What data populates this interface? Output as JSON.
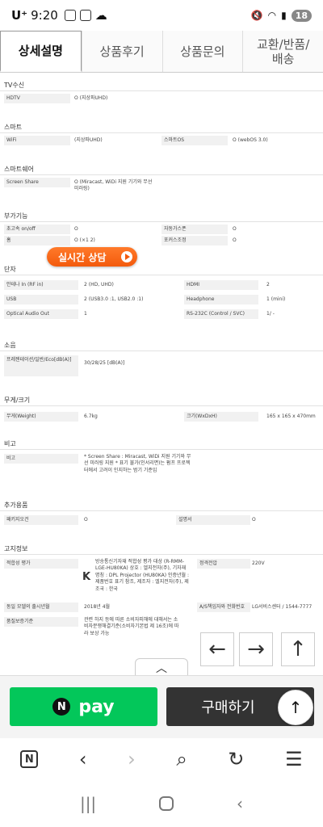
{
  "status": {
    "carrier": "U⁺",
    "time": "9:20",
    "battery": "18"
  },
  "tabs": [
    {
      "label": "상세설명"
    },
    {
      "label": "상품후기"
    },
    {
      "label": "상품문의"
    },
    {
      "label": "교환/반품/\n배송"
    }
  ],
  "sections": {
    "tv": {
      "title": "TV수신",
      "rows": [
        [
          "HDTV",
          "O (지상파UHD)"
        ]
      ]
    },
    "smart": {
      "title": "스마트",
      "rows": [
        [
          "WiFi",
          "(지상파UHD)",
          "스마트OS",
          "O (webOS 3.0)"
        ]
      ]
    },
    "share": {
      "title": "스마트쉐어",
      "rows": [
        [
          "Screen Share",
          "O (Miracast, WiDi 지원 기기와 무선 미러링)"
        ]
      ]
    },
    "extra": {
      "title": "부가기능",
      "rows": [
        [
          "초고속 on/off",
          "O",
          "자동가스폰",
          "O"
        ],
        [
          "홈",
          "O (×1 2)",
          "포커스조정",
          "O"
        ]
      ]
    },
    "ports": {
      "title": "단자",
      "rows": [
        [
          "안테나 In (RF in)",
          "2 (HD, UHD)",
          "HDMI",
          "2"
        ],
        [
          "USB",
          "2 (USB3.0 :1, USB2.0 :1)",
          "Headphone",
          "1 (mini)"
        ],
        [
          "Optical Audio Out",
          "1",
          "RS-232C (Control / SVC)",
          "1/ -"
        ]
      ]
    },
    "noise": {
      "title": "소음",
      "rows": [
        [
          "프레젠테이션/일반/Eco[dB(A)]",
          "30/28/25 [dB(A)]"
        ]
      ]
    },
    "size": {
      "title": "무게/크기",
      "rows": [
        [
          "무게(Weight)",
          "6.7kg",
          "크기(WxDxH)",
          "165 x 165 x 470mm"
        ]
      ]
    },
    "note": {
      "title": "비고",
      "rows": [
        [
          "비고",
          "* Screen Share : Miracast, WiDi 지원 기기와 무선 미러링 지원 * 표기 불가(인서리면)는 펌프 프로젝터에서 고려이 인지하는 범기 기준임"
        ]
      ]
    },
    "addon": {
      "title": "추가용품",
      "rows": [
        [
          "패키지오건",
          "O",
          "설명서",
          "O"
        ]
      ]
    },
    "notice": {
      "title": "고지정보",
      "rows": [
        [
          "적합성 평가",
          "방송통신기자재 적합성 평가 대상 (R-RMM-LGE-HU80KA) 상호 : 엘지전자(주), 기자재 명칭 : DPL Projector (HU80KA) 인증년월 : 제품번호 표기 참조, 제조자 : 엘지전자(주), 제조국 : 한국",
          "정격전압",
          "220V"
        ],
        [
          "동일 모델의 출시년월",
          "2018년 4월",
          "A/S책임자와 전화번호",
          "LG서비스센터 / 1544-7777"
        ],
        [
          "품질보증기준",
          "관련 하지 등에 따른 소비자피해에 대해서는 소비자분쟁해결기준(소비자기본법 제 16조)에 따라 보상 가능",
          "",
          ""
        ]
      ]
    }
  },
  "live_button": {
    "label": "실시간 상담"
  },
  "buybar": {
    "npay_label": "pay",
    "npay_n": "N",
    "buy_label": "구매하기"
  },
  "colors": {
    "npay": "#03c75a",
    "buy": "#333333",
    "live": "#f35a0c"
  }
}
